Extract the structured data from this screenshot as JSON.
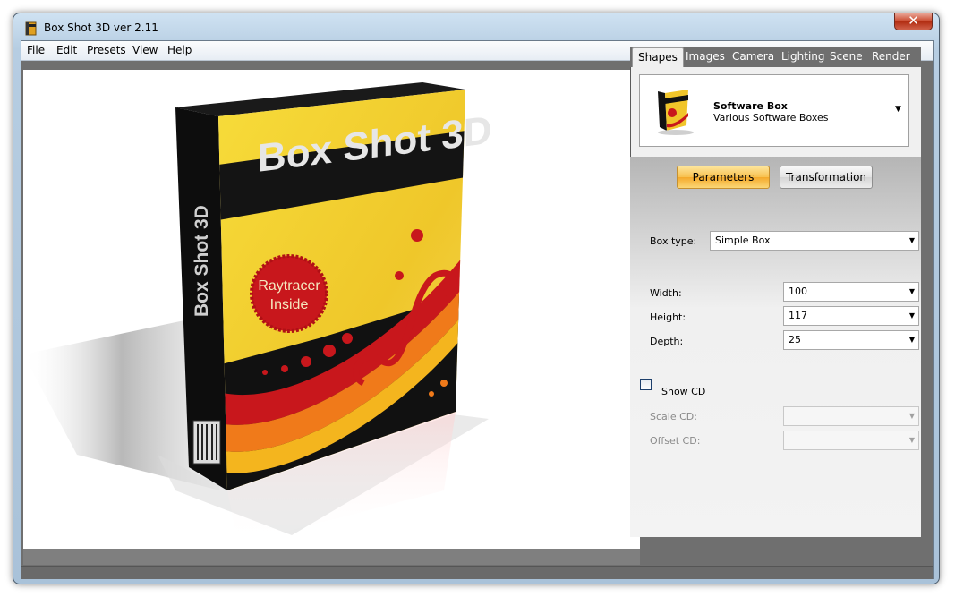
{
  "window": {
    "title": "Box Shot 3D ver 2.11",
    "close_label": "✕"
  },
  "menu": {
    "items": [
      {
        "accel": "F",
        "rest": "ile"
      },
      {
        "accel": "E",
        "rest": "dit"
      },
      {
        "accel": "P",
        "rest": "resets"
      },
      {
        "accel": "V",
        "rest": "iew"
      },
      {
        "accel": "H",
        "rest": "elp"
      }
    ]
  },
  "tabs": [
    "Shapes",
    "Images",
    "Camera",
    "Lighting",
    "Scene",
    "Render"
  ],
  "active_tab": "Shapes",
  "shape": {
    "title": "Software Box",
    "subtitle": "Various Software Boxes"
  },
  "buttons": {
    "parameters": "Parameters",
    "transformation": "Transformation"
  },
  "params": {
    "box_type_label": "Box type:",
    "box_type_value": "Simple Box",
    "width_label": "Width:",
    "width_value": "100",
    "height_label": "Height:",
    "height_value": "117",
    "depth_label": "Depth:",
    "depth_value": "25",
    "show_cd_label": "Show CD",
    "show_cd_checked": false,
    "scale_cd_label": "Scale CD:",
    "offset_cd_label": "Offset CD:"
  },
  "box_art": {
    "title": "Box Shot 3D",
    "spine_text": "Box Shot 3D",
    "badge_line1": "Raytracer",
    "badge_line2": "Inside"
  },
  "colors": {
    "accent_orange": "#f8c04e",
    "box_yellow": "#f4cf2a",
    "box_black": "#111111",
    "badge_red": "#c8171c"
  }
}
